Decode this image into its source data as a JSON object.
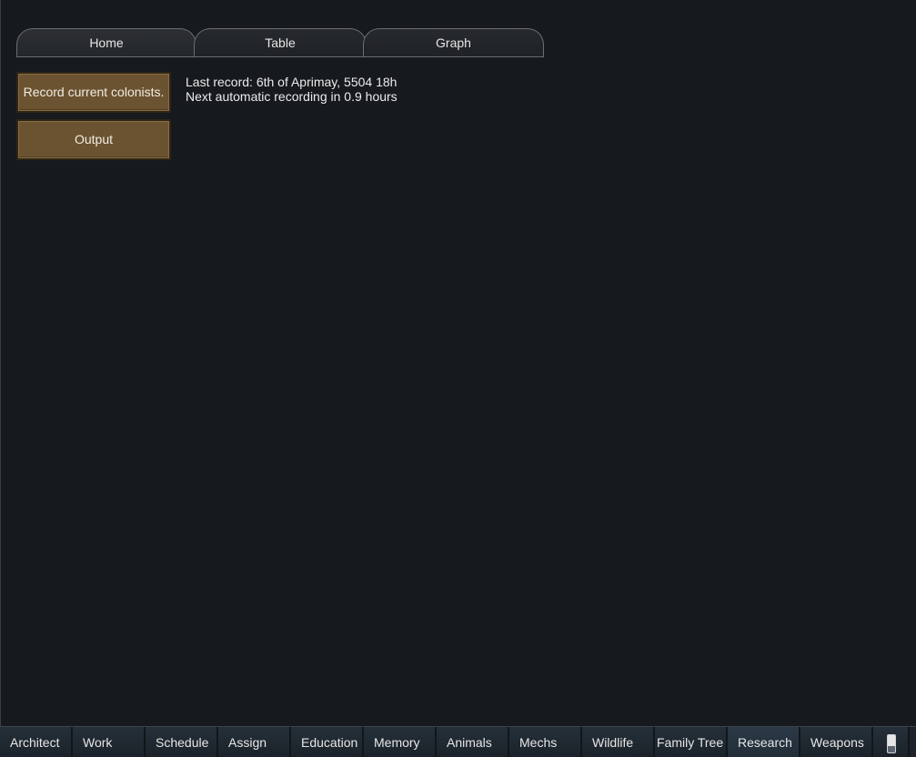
{
  "tabs": [
    {
      "label": "Home"
    },
    {
      "label": "Table"
    },
    {
      "label": "Graph"
    }
  ],
  "buttons": {
    "record_label": "Record current colonists.",
    "output_label": "Output"
  },
  "info": {
    "last_record": "Last record: 6th of Aprimay, 5504 18h",
    "next_recording": "Next automatic recording in 0.9 hours"
  },
  "bottom_bar": {
    "items": [
      {
        "label": "Architect"
      },
      {
        "label": "Work"
      },
      {
        "label": "Schedule"
      },
      {
        "label": "Assign"
      },
      {
        "label": "Education"
      },
      {
        "label": "Memory"
      },
      {
        "label": "Animals"
      },
      {
        "label": "Mechs"
      },
      {
        "label": "Wildlife"
      },
      {
        "label": "Family Tree"
      },
      {
        "label": "Research"
      },
      {
        "label": "Weapons"
      }
    ],
    "icon": "battery-icon"
  }
}
